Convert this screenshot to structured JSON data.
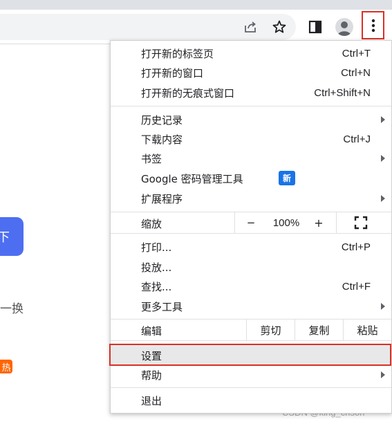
{
  "page": {
    "blue_button_fragment": "下",
    "swap_text": "一换",
    "hot_badge": "热",
    "watermark": "CSDN @king_crison"
  },
  "toolbar": {
    "icons": [
      "share-icon",
      "bookmark-star-icon",
      "side-panel-icon",
      "profile-avatar-icon",
      "more-vert-icon"
    ]
  },
  "menu": {
    "new_tab": {
      "label": "打开新的标签页",
      "shortcut": "Ctrl+T"
    },
    "new_window": {
      "label": "打开新的窗口",
      "shortcut": "Ctrl+N"
    },
    "new_incognito": {
      "label": "打开新的无痕式窗口",
      "shortcut": "Ctrl+Shift+N"
    },
    "history": {
      "label": "历史记录"
    },
    "downloads": {
      "label": "下载内容",
      "shortcut": "Ctrl+J"
    },
    "bookmarks": {
      "label": "书签"
    },
    "password_manager": {
      "label": "Google 密码管理工具",
      "badge": "新"
    },
    "extensions": {
      "label": "扩展程序"
    },
    "zoom": {
      "label": "缩放",
      "minus": "−",
      "value": "100%",
      "plus": "+"
    },
    "print": {
      "label": "打印...",
      "shortcut": "Ctrl+P"
    },
    "cast": {
      "label": "投放..."
    },
    "find": {
      "label": "查找...",
      "shortcut": "Ctrl+F"
    },
    "more_tools": {
      "label": "更多工具"
    },
    "edit": {
      "label": "编辑",
      "cut": "剪切",
      "copy": "复制",
      "paste": "粘贴"
    },
    "settings": {
      "label": "设置"
    },
    "help": {
      "label": "帮助"
    },
    "exit": {
      "label": "退出"
    }
  },
  "colors": {
    "highlight_border": "#d93025",
    "new_badge": "#1a73e8",
    "page_button": "#4e6ef2",
    "hot_badge": "#ff6600"
  }
}
